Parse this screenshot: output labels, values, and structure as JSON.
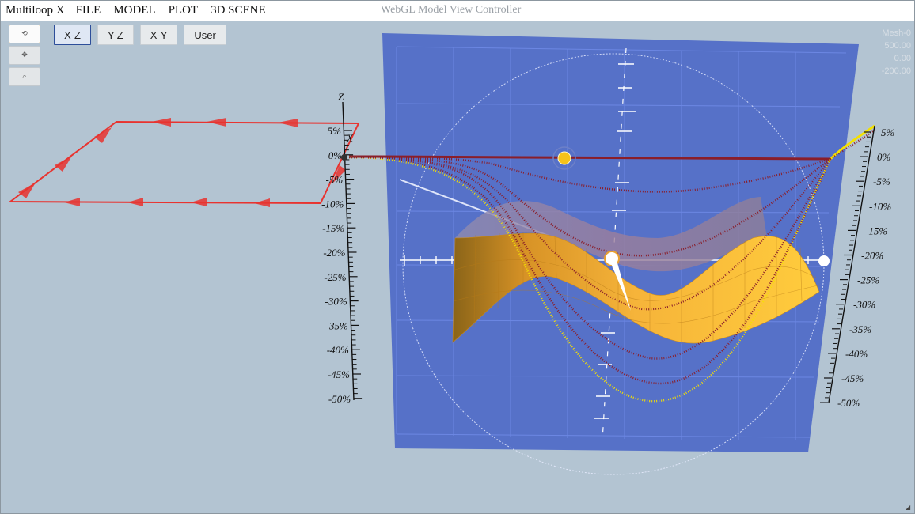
{
  "app": {
    "name": "Multiloop X",
    "menus": [
      "FILE",
      "MODEL",
      "PLOT",
      "3D SCENE"
    ],
    "window_title": "WebGL Model View Controller"
  },
  "tools": [
    {
      "name": "rotate-icon",
      "glyph": "⟲",
      "active": true
    },
    {
      "name": "pan-icon",
      "glyph": "✥",
      "active": false
    },
    {
      "name": "zoom-icon",
      "glyph": "⌕",
      "active": false
    }
  ],
  "views": [
    {
      "label": "X-Z",
      "active": true
    },
    {
      "label": "Y-Z",
      "active": false
    },
    {
      "label": "X-Y",
      "active": false
    },
    {
      "label": "User",
      "active": false
    }
  ],
  "mesh_info": [
    "Mesh-0",
    "500.00",
    "0.00",
    "-200.00"
  ],
  "axes": {
    "left_axis_letters": {
      "z": "Z",
      "x": "X"
    },
    "tick_labels": [
      "5%",
      "0%",
      "-5%",
      "-10%",
      "-15%",
      "-20%",
      "-25%",
      "-30%",
      "-35%",
      "-40%",
      "-45%",
      "-50%"
    ]
  },
  "colors": {
    "background": "#b3c4d2",
    "plane": "#4e69c7",
    "surface": "#f2a530",
    "curve_dark": "#8a1e2a",
    "curve_yellow": "#f5e100",
    "loop": "#e8332f"
  }
}
